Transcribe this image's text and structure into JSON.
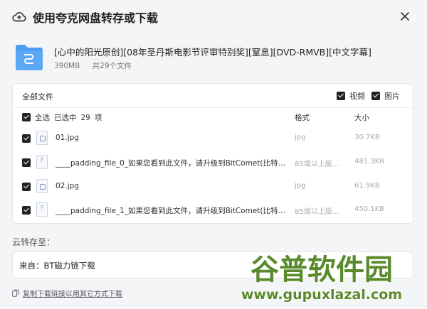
{
  "header": {
    "title": "使用夸克网盘转存或下载",
    "icon": "cloud-icon"
  },
  "package": {
    "name": "[心中的阳光原创][08年圣丹斯电影节评审特别奖][窒息][DVD-RMVB][中文字幕]",
    "size": "390MB",
    "count": "共29个文件"
  },
  "file_panel": {
    "all_label": "全部文件",
    "filter_video": "视频",
    "filter_image": "图片",
    "select_all": "全选",
    "selected_prefix": "已选中",
    "selected_count": "29",
    "selected_suffix": "项",
    "col_format": "格式",
    "col_size": "大小"
  },
  "files": [
    {
      "name": "01.jpg",
      "format": "jpg",
      "size": "30.7KB",
      "kind": "image"
    },
    {
      "name": "____padding_file_0_如果您看到此文件，请升级到BitComet(比特彗星)...",
      "format": "85或以上版本...",
      "size": "481.3KB",
      "kind": "unknown"
    },
    {
      "name": "02.jpg",
      "format": "jpg",
      "size": "61.9KB",
      "kind": "image"
    },
    {
      "name": "____padding_file_1_如果您看到此文件，请升级到BitComet(比特彗星)...",
      "format": "85或以上版本...",
      "size": "450.1KB",
      "kind": "unknown"
    }
  ],
  "save": {
    "label": "云转存至：",
    "destination": "来自：BT磁力链下载"
  },
  "footer": {
    "copy_link": "复制下载链接以用其它方式下载"
  },
  "watermark": {
    "line1": "谷普软件园",
    "line2": "www.gupuxlazal.com"
  },
  "colors": {
    "accent_folder": "#4f9ef2",
    "checkbox": "#222222",
    "watermark_green": "#5a8a2c"
  }
}
